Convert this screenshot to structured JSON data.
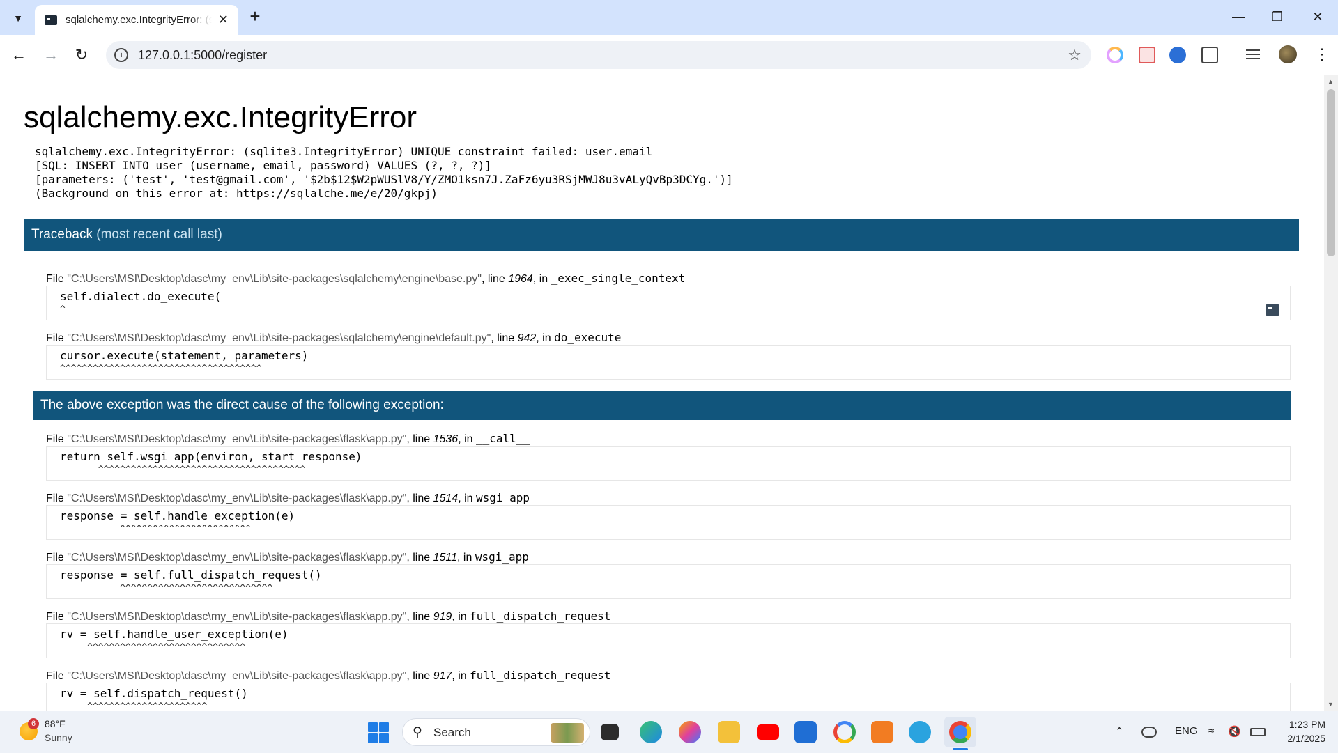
{
  "browser": {
    "tab_title": "sqlalchemy.exc.IntegrityError: (s",
    "url": "127.0.0.1:5000/register"
  },
  "page": {
    "title": "sqlalchemy.exc.IntegrityError",
    "error_message": "sqlalchemy.exc.IntegrityError: (sqlite3.IntegrityError) UNIQUE constraint failed: user.email\n[SQL: INSERT INTO user (username, email, password) VALUES (?, ?, ?)]\n[parameters: ('test', 'test@gmail.com', '$2b$12$W2pWUSlV8/Y/ZMO1ksn7J.ZaFz6yu3RSjMWJ8u3vALyQvBp3DCYg.')]\n(Background on this error at: https://sqlalche.me/e/20/gkpj)",
    "traceback_label": "Traceback",
    "traceback_sub": "(most recent call last)",
    "cause_text": "The above exception was the direct cause of the following exception:",
    "frames": [
      {
        "file_prefix": "File ",
        "path": "\"C:\\Users\\MSI\\Desktop\\dasc\\my_env\\Lib\\site-packages\\sqlalchemy\\engine\\base.py\"",
        "line_label": ", line ",
        "line": "1964",
        "in_label": ", in ",
        "func": "_exec_single_context",
        "code": "self.dialect.do_execute(",
        "carets": "^"
      },
      {
        "file_prefix": "File ",
        "path": "\"C:\\Users\\MSI\\Desktop\\dasc\\my_env\\Lib\\site-packages\\sqlalchemy\\engine\\default.py\"",
        "line_label": ", line ",
        "line": "942",
        "in_label": ", in ",
        "func": "do_execute",
        "code": "cursor.execute(statement, parameters)",
        "carets": "^^^^^^^^^^^^^^^^^^^^^^^^^^^^^^^^^^^^^"
      },
      {
        "file_prefix": "File ",
        "path": "\"C:\\Users\\MSI\\Desktop\\dasc\\my_env\\Lib\\site-packages\\flask\\app.py\"",
        "line_label": ", line ",
        "line": "1536",
        "in_label": ", in ",
        "func": "__call__",
        "code": "return self.wsgi_app(environ, start_response)",
        "carets": "       ^^^^^^^^^^^^^^^^^^^^^^^^^^^^^^^^^^^^^^"
      },
      {
        "file_prefix": "File ",
        "path": "\"C:\\Users\\MSI\\Desktop\\dasc\\my_env\\Lib\\site-packages\\flask\\app.py\"",
        "line_label": ", line ",
        "line": "1514",
        "in_label": ", in ",
        "func": "wsgi_app",
        "code": "response = self.handle_exception(e)",
        "carets": "           ^^^^^^^^^^^^^^^^^^^^^^^^"
      },
      {
        "file_prefix": "File ",
        "path": "\"C:\\Users\\MSI\\Desktop\\dasc\\my_env\\Lib\\site-packages\\flask\\app.py\"",
        "line_label": ", line ",
        "line": "1511",
        "in_label": ", in ",
        "func": "wsgi_app",
        "code": "response = self.full_dispatch_request()",
        "carets": "           ^^^^^^^^^^^^^^^^^^^^^^^^^^^^"
      },
      {
        "file_prefix": "File ",
        "path": "\"C:\\Users\\MSI\\Desktop\\dasc\\my_env\\Lib\\site-packages\\flask\\app.py\"",
        "line_label": ", line ",
        "line": "919",
        "in_label": ", in ",
        "func": "full_dispatch_request",
        "code": "rv = self.handle_user_exception(e)",
        "carets": "     ^^^^^^^^^^^^^^^^^^^^^^^^^^^^^"
      },
      {
        "file_prefix": "File ",
        "path": "\"C:\\Users\\MSI\\Desktop\\dasc\\my_env\\Lib\\site-packages\\flask\\app.py\"",
        "line_label": ", line ",
        "line": "917",
        "in_label": ", in ",
        "func": "full_dispatch_request",
        "code": "rv = self.dispatch_request()",
        "carets": "     ^^^^^^^^^^^^^^^^^^^^^^"
      }
    ]
  },
  "taskbar": {
    "weather_temp": "88°F",
    "weather_cond": "Sunny",
    "weather_badge": "6",
    "search_label": "Search",
    "lang": "ENG",
    "time": "1:23 PM",
    "date": "2/1/2025"
  },
  "colors": {
    "traceback_header": "#11557c",
    "path_text": "#555555",
    "tab_strip": "#d3e3fd"
  }
}
